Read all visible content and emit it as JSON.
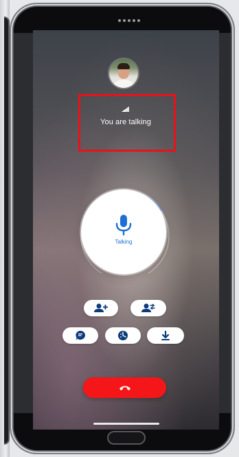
{
  "call": {
    "status_text": "You are talking",
    "talk_button_label": "Talking"
  },
  "icons": {
    "signal": "signal-strength-icon",
    "mic": "microphone-icon",
    "add_participant": "add-user-icon",
    "transfer": "transfer-user-icon",
    "chat": "chat-bubble-icon",
    "dialpad": "dialpad-icon",
    "download": "download-icon",
    "end_call": "hang-up-icon"
  },
  "colors": {
    "accent_blue": "#1d6fd1",
    "end_call_red": "#f5161a",
    "highlight_red": "#e8121b"
  }
}
